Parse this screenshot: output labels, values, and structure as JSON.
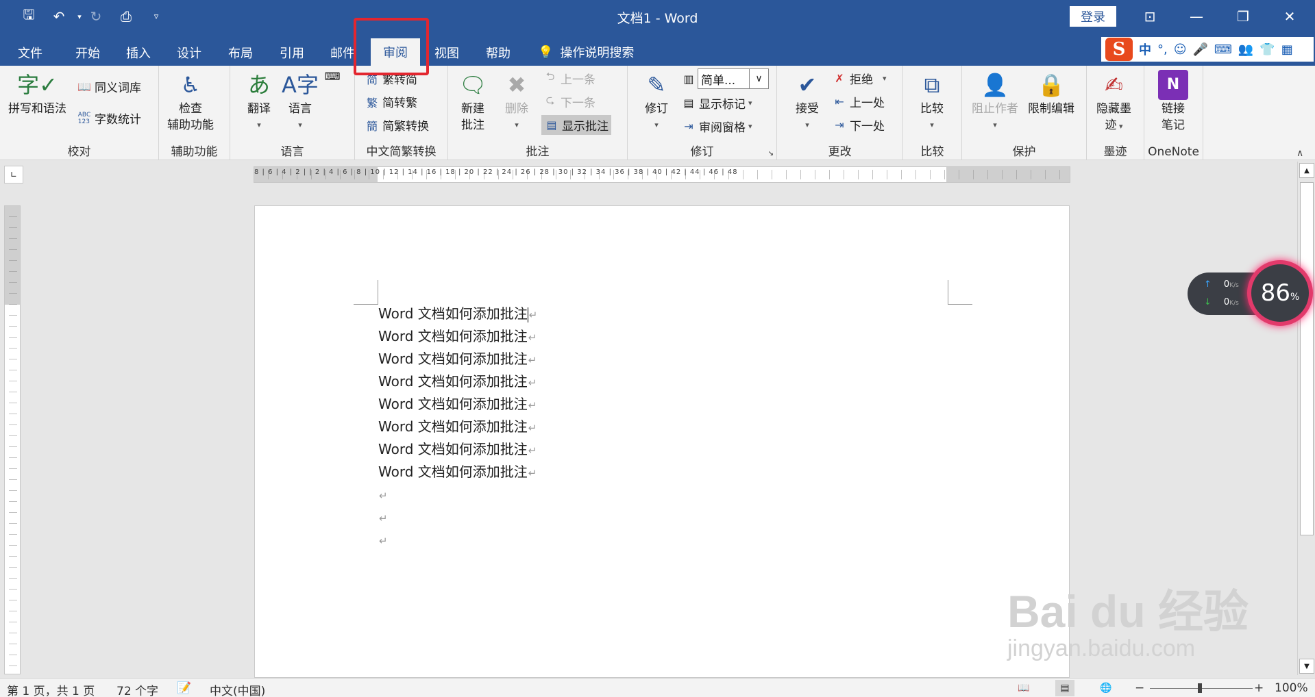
{
  "title_bar": {
    "doc_title": "文档1  -  Word",
    "login": "登录"
  },
  "tabs": [
    "文件",
    "开始",
    "插入",
    "设计",
    "布局",
    "引用",
    "邮件",
    "审阅",
    "视图",
    "帮助"
  ],
  "active_tab": "审阅",
  "tell_me": "操作说明搜索",
  "ime": {
    "lang": "中",
    "punct": "°,"
  },
  "ribbon": {
    "proofing": {
      "spelling": "拼写和语法",
      "thesaurus": "同义词库",
      "word_count": "字数统计",
      "label": "校对"
    },
    "accessibility": {
      "check_line1": "检查",
      "check_line2": "辅助功能",
      "label": "辅助功能"
    },
    "language": {
      "translate": "翻译",
      "language": "语言",
      "label": "语言"
    },
    "chinese": {
      "to_simplified": "繁转简",
      "to_traditional": "简转繁",
      "convert": "简繁转换",
      "label": "中文简繁转换"
    },
    "comments": {
      "new_line1": "新建",
      "new_line2": "批注",
      "delete": "删除",
      "previous": "上一条",
      "next": "下一条",
      "show": "显示批注",
      "label": "批注"
    },
    "tracking": {
      "track": "修订",
      "markup_select": "简单...",
      "show_markup": "显示标记",
      "reviewing_pane": "审阅窗格",
      "label": "修订"
    },
    "changes": {
      "accept": "接受",
      "reject": "拒绝",
      "previous": "上一处",
      "next": "下一处",
      "label": "更改"
    },
    "compare": {
      "compare": "比较",
      "label": "比较"
    },
    "protect": {
      "block_authors": "阻止作者",
      "restrict": "限制编辑",
      "label": "保护"
    },
    "ink": {
      "hide_line1": "隐藏墨",
      "hide_line2": "迹",
      "label": "墨迹"
    },
    "onenote": {
      "link_line1": "链接",
      "link_line2": "笔记",
      "label": "OneNote"
    }
  },
  "ruler_labels": "8  |  6  |  4  |  2  |     |  2  |  4  |  6  |  8  | 10 | 12 | 14 | 16 | 18 | 20 | 22 | 24 | 26 | 28 | 30 | 32 | 34 | 36 | 38 |  40 | 42 | 44 | 46 | 48",
  "document": {
    "paragraphs": [
      "Word 文档如何添加批注",
      "Word 文档如何添加批注",
      "Word 文档如何添加批注",
      "Word 文档如何添加批注",
      "Word 文档如何添加批注",
      "Word 文档如何添加批注",
      "Word 文档如何添加批注",
      "Word 文档如何添加批注"
    ],
    "paragraph_mark": "↵"
  },
  "net_widget": {
    "up": "0",
    "down": "0",
    "unit": "K/s",
    "gauge": "86",
    "gauge_unit": "%"
  },
  "status": {
    "page": "第 1 页，共 1 页",
    "words": "72 个字",
    "language": "中文(中国)",
    "zoom": "100%",
    "zoom_minus": "−",
    "zoom_plus": "+"
  },
  "watermark": {
    "brand": "Bai  du 经验",
    "url": "jingyan.baidu.com"
  },
  "colors": {
    "title_blue": "#2b579a",
    "highlight_red": "#e3262f",
    "gauge_pink": "#e23a6b"
  }
}
